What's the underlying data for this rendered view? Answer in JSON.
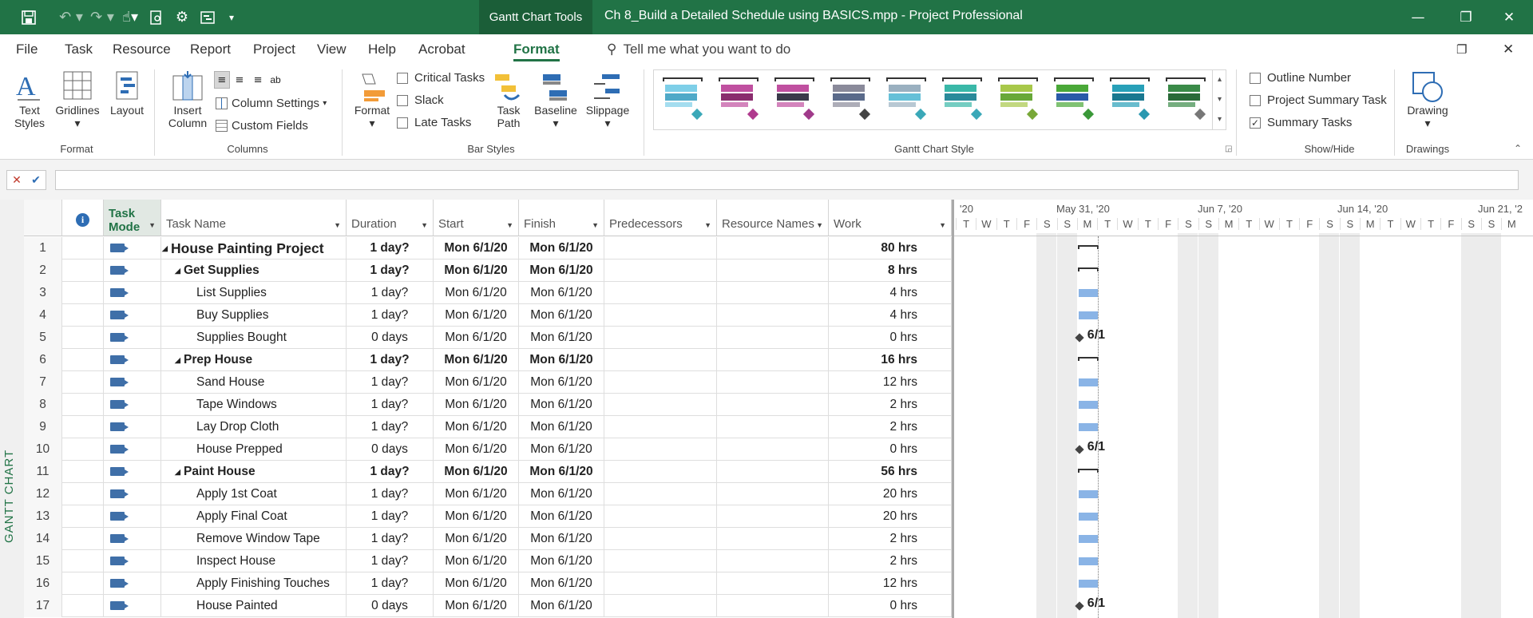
{
  "titlebar": {
    "context_tab": "Gantt Chart Tools",
    "title": "Ch 8_Build a Detailed Schedule using BASICS.mpp  -  Project Professional"
  },
  "menu": [
    "File",
    "Task",
    "Resource",
    "Report",
    "Project",
    "View",
    "Help",
    "Acrobat",
    "Format"
  ],
  "menu_active": "Format",
  "tell_me": "Tell me what you want to do",
  "ribbon": {
    "format_group": {
      "label": "Format",
      "text_styles": "Text Styles",
      "gridlines": "Gridlines",
      "layout": "Layout"
    },
    "columns_group": {
      "label": "Columns",
      "insert_column": "Insert Column",
      "column_settings": "Column Settings",
      "custom_fields": "Custom Fields"
    },
    "bar_styles_group": {
      "label": "Bar Styles",
      "format": "Format",
      "critical_tasks": "Critical Tasks",
      "slack": "Slack",
      "late_tasks": "Late Tasks",
      "task_path": "Task Path",
      "baseline": "Baseline",
      "slippage": "Slippage"
    },
    "gantt_style_group": {
      "label": "Gantt Chart Style"
    },
    "show_hide_group": {
      "label": "Show/Hide",
      "outline_number": "Outline Number",
      "project_summary_task": "Project Summary Task",
      "summary_tasks": "Summary Tasks"
    },
    "drawings_group": {
      "label": "Drawings",
      "drawing": "Drawing"
    }
  },
  "gantt_styles": [
    {
      "a": "#7ecfe8",
      "b": "#4fa9c8",
      "d": "#3aa8b8"
    },
    {
      "a": "#c050a0",
      "b": "#8a2d6e",
      "d": "#b03a8e"
    },
    {
      "a": "#c050a0",
      "b": "#3a3a4a",
      "d": "#a03a8a"
    },
    {
      "a": "#8a8a9a",
      "b": "#5a6a8a",
      "d": "#444"
    },
    {
      "a": "#9ab0c0",
      "b": "#66c0d8",
      "d": "#3aa8b8"
    },
    {
      "a": "#3ab8a8",
      "b": "#2a8a9a",
      "d": "#3aa8b8"
    },
    {
      "a": "#a8c84a",
      "b": "#68a838",
      "d": "#78a838"
    },
    {
      "a": "#4aa838",
      "b": "#2a5aa8",
      "d": "#3a9838"
    },
    {
      "a": "#28a0b8",
      "b": "#1a7890",
      "d": "#2a98b0"
    },
    {
      "a": "#3a8a48",
      "b": "#2a6a38",
      "d": "#777"
    }
  ],
  "columns": {
    "indicators": "i",
    "task_mode": "Task Mode",
    "task_name": "Task Name",
    "duration": "Duration",
    "start": "Start",
    "finish": "Finish",
    "predecessors": "Predecessors",
    "resource_names": "Resource Names",
    "work": "Work"
  },
  "sidebar_label": "GANTT CHART",
  "tasks": [
    {
      "id": "1",
      "name": "House Painting Project",
      "duration": "1 day?",
      "start": "Mon 6/1/20",
      "finish": "Mon 6/1/20",
      "work": "80 hrs",
      "level": 0,
      "summary": true
    },
    {
      "id": "2",
      "name": "Get Supplies",
      "duration": "1 day?",
      "start": "Mon 6/1/20",
      "finish": "Mon 6/1/20",
      "work": "8 hrs",
      "level": 1,
      "summary": true
    },
    {
      "id": "3",
      "name": "List Supplies",
      "duration": "1 day?",
      "start": "Mon 6/1/20",
      "finish": "Mon 6/1/20",
      "work": "4 hrs",
      "level": 2,
      "summary": false
    },
    {
      "id": "4",
      "name": "Buy Supplies",
      "duration": "1 day?",
      "start": "Mon 6/1/20",
      "finish": "Mon 6/1/20",
      "work": "4 hrs",
      "level": 2,
      "summary": false
    },
    {
      "id": "5",
      "name": "Supplies Bought",
      "duration": "0 days",
      "start": "Mon 6/1/20",
      "finish": "Mon 6/1/20",
      "work": "0 hrs",
      "level": 2,
      "summary": false,
      "milestone": "6/1"
    },
    {
      "id": "6",
      "name": "Prep House",
      "duration": "1 day?",
      "start": "Mon 6/1/20",
      "finish": "Mon 6/1/20",
      "work": "16 hrs",
      "level": 1,
      "summary": true
    },
    {
      "id": "7",
      "name": "Sand House",
      "duration": "1 day?",
      "start": "Mon 6/1/20",
      "finish": "Mon 6/1/20",
      "work": "12 hrs",
      "level": 2,
      "summary": false
    },
    {
      "id": "8",
      "name": "Tape Windows",
      "duration": "1 day?",
      "start": "Mon 6/1/20",
      "finish": "Mon 6/1/20",
      "work": "2 hrs",
      "level": 2,
      "summary": false
    },
    {
      "id": "9",
      "name": "Lay Drop Cloth",
      "duration": "1 day?",
      "start": "Mon 6/1/20",
      "finish": "Mon 6/1/20",
      "work": "2 hrs",
      "level": 2,
      "summary": false
    },
    {
      "id": "10",
      "name": "House Prepped",
      "duration": "0 days",
      "start": "Mon 6/1/20",
      "finish": "Mon 6/1/20",
      "work": "0 hrs",
      "level": 2,
      "summary": false,
      "milestone": "6/1"
    },
    {
      "id": "11",
      "name": "Paint House",
      "duration": "1 day?",
      "start": "Mon 6/1/20",
      "finish": "Mon 6/1/20",
      "work": "56 hrs",
      "level": 1,
      "summary": true
    },
    {
      "id": "12",
      "name": "Apply 1st Coat",
      "duration": "1 day?",
      "start": "Mon 6/1/20",
      "finish": "Mon 6/1/20",
      "work": "20 hrs",
      "level": 2,
      "summary": false
    },
    {
      "id": "13",
      "name": "Apply Final Coat",
      "duration": "1 day?",
      "start": "Mon 6/1/20",
      "finish": "Mon 6/1/20",
      "work": "20 hrs",
      "level": 2,
      "summary": false
    },
    {
      "id": "14",
      "name": "Remove Window Tape",
      "duration": "1 day?",
      "start": "Mon 6/1/20",
      "finish": "Mon 6/1/20",
      "work": "2 hrs",
      "level": 2,
      "summary": false
    },
    {
      "id": "15",
      "name": "Inspect House",
      "duration": "1 day?",
      "start": "Mon 6/1/20",
      "finish": "Mon 6/1/20",
      "work": "2 hrs",
      "level": 2,
      "summary": false
    },
    {
      "id": "16",
      "name": "Apply Finishing Touches",
      "duration": "1 day?",
      "start": "Mon 6/1/20",
      "finish": "Mon 6/1/20",
      "work": "12 hrs",
      "level": 2,
      "summary": false
    },
    {
      "id": "17",
      "name": "House Painted",
      "duration": "0 days",
      "start": "Mon 6/1/20",
      "finish": "Mon 6/1/20",
      "work": "0 hrs",
      "level": 2,
      "summary": false,
      "milestone": "6/1"
    }
  ],
  "timescale": {
    "weeks": [
      "'20",
      "May 31, '20",
      "Jun 7, '20",
      "Jun 14, '20",
      "Jun 21, '2"
    ],
    "days": [
      "T",
      "W",
      "T",
      "F",
      "S",
      "S",
      "M",
      "T",
      "W",
      "T",
      "F",
      "S",
      "S",
      "M",
      "T",
      "W",
      "T",
      "F",
      "S",
      "S",
      "M",
      "T",
      "W",
      "T",
      "F",
      "S",
      "S",
      "M"
    ]
  },
  "colors": {
    "accent": "#217346",
    "bar": "#8ab4e6"
  }
}
